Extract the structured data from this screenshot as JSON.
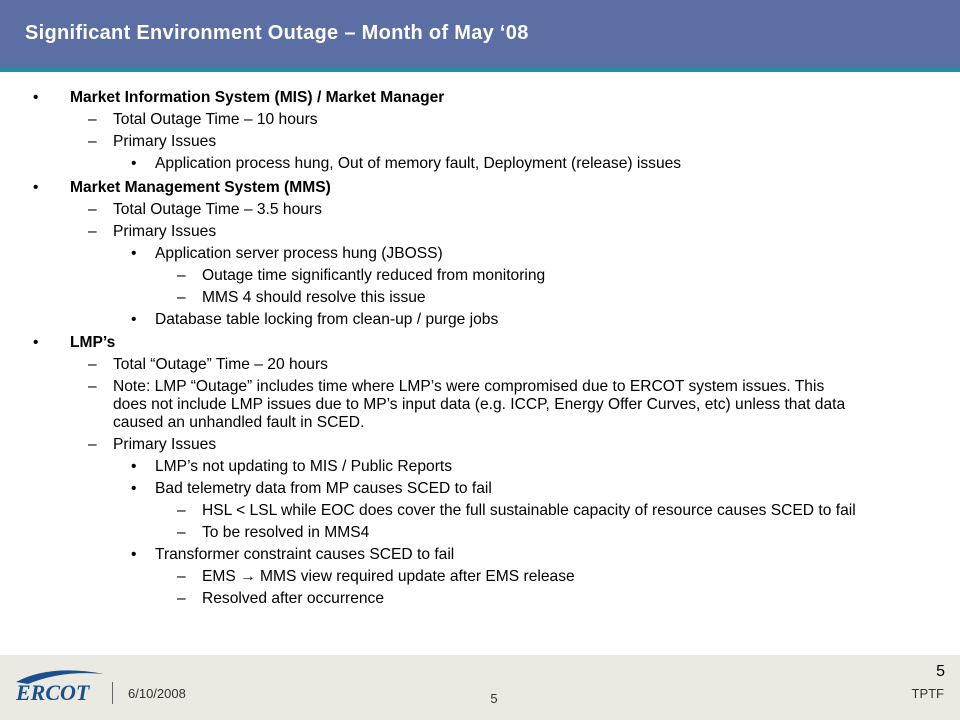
{
  "slide": {
    "title": "Significant Environment Outage – Month of May ‘08",
    "colors": {
      "header": "#5b6fa4",
      "accent_line": "#1f8fa6",
      "footer": "#eae9e2",
      "logo_blue": "#1b4f8f"
    }
  },
  "bullets": [
    {
      "level": 1,
      "marker": "•",
      "text": "Market Information System (MIS) / Market Manager"
    },
    {
      "level": 2,
      "marker": "–",
      "text": "Total Outage Time – 10 hours"
    },
    {
      "level": 2,
      "marker": "–",
      "text": "Primary Issues"
    },
    {
      "level": 3,
      "marker": "•",
      "text": "Application process hung, Out of memory fault, Deployment (release) issues"
    },
    {
      "level": 1,
      "marker": "•",
      "text": "Market Management System (MMS)"
    },
    {
      "level": 2,
      "marker": "–",
      "text": "Total Outage Time – 3.5 hours"
    },
    {
      "level": 2,
      "marker": "–",
      "text": "Primary Issues"
    },
    {
      "level": 3,
      "marker": "•",
      "text": "Application server process hung (JBOSS)"
    },
    {
      "level": 4,
      "marker": "–",
      "text": "Outage time significantly reduced from monitoring"
    },
    {
      "level": 4,
      "marker": "–",
      "text": "MMS 4 should resolve this issue"
    },
    {
      "level": 3,
      "marker": "•",
      "text": "Database table locking from clean-up / purge jobs"
    },
    {
      "level": 1,
      "marker": "•",
      "text": "LMP’s"
    },
    {
      "level": 2,
      "marker": "–",
      "text": "Total “Outage” Time – 20 hours"
    },
    {
      "level": 2,
      "marker": "–",
      "text": "Note: LMP “Outage” includes time where LMP’s were compromised due to ERCOT system issues.  This does not include LMP issues due to MP’s input data (e.g. ICCP, Energy Offer Curves, etc) unless that data caused an unhandled fault in SCED."
    },
    {
      "level": 2,
      "marker": "–",
      "text": "Primary Issues"
    },
    {
      "level": 3,
      "marker": "•",
      "text": "LMP’s not updating to MIS / Public Reports"
    },
    {
      "level": 3,
      "marker": "•",
      "text": "Bad telemetry data from MP causes SCED to fail"
    },
    {
      "level": 4,
      "marker": "–",
      "text": "HSL <  LSL while EOC does cover the full sustainable capacity of resource causes SCED to fail"
    },
    {
      "level": 4,
      "marker": "–",
      "text": "To be resolved in MMS4"
    },
    {
      "level": 3,
      "marker": "•",
      "text": "Transformer constraint causes SCED to fail"
    },
    {
      "level": 4,
      "marker": "–",
      "text": "EMS → MMS view required update after EMS release"
    },
    {
      "level": 4,
      "marker": "–",
      "text": "Resolved after occurrence"
    }
  ],
  "footer": {
    "logo_text": "ERCOT",
    "date": "6/10/2008",
    "page_center": "5",
    "page_right": "5",
    "org": "TPTF"
  }
}
